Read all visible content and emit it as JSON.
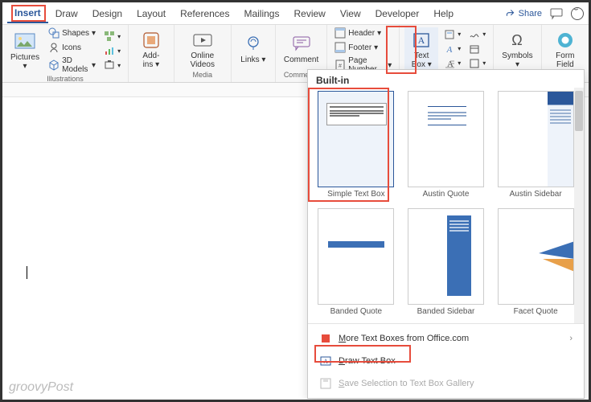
{
  "tabs": [
    "Insert",
    "Draw",
    "Design",
    "Layout",
    "References",
    "Mailings",
    "Review",
    "View",
    "Developer",
    "Help"
  ],
  "top": {
    "share": "Share"
  },
  "ribbon": {
    "pictures": "Pictures",
    "shapes": "Shapes",
    "icons": "Icons",
    "models3d": "3D Models",
    "grp_illustrations": "Illustrations",
    "addins": "Add-\nins",
    "online_videos": "Online\nVideos",
    "grp_media": "Media",
    "links": "Links",
    "comment": "Comment",
    "grp_comments": "Comments",
    "header": "Header",
    "footer": "Footer",
    "page_number": "Page Number",
    "text_box": "Text\nBox",
    "symbols": "Symbols",
    "form_field": "Form\nField"
  },
  "gallery": {
    "heading": "Built-in",
    "items": [
      "Simple Text Box",
      "Austin Quote",
      "Austin Sidebar",
      "Banded Quote",
      "Banded Sidebar",
      "Facet Quote"
    ],
    "more": "More Text Boxes from Office.com",
    "draw": "Draw Text Box",
    "save": "Save Selection to Text Box Gallery"
  },
  "watermark": "groovyPost"
}
